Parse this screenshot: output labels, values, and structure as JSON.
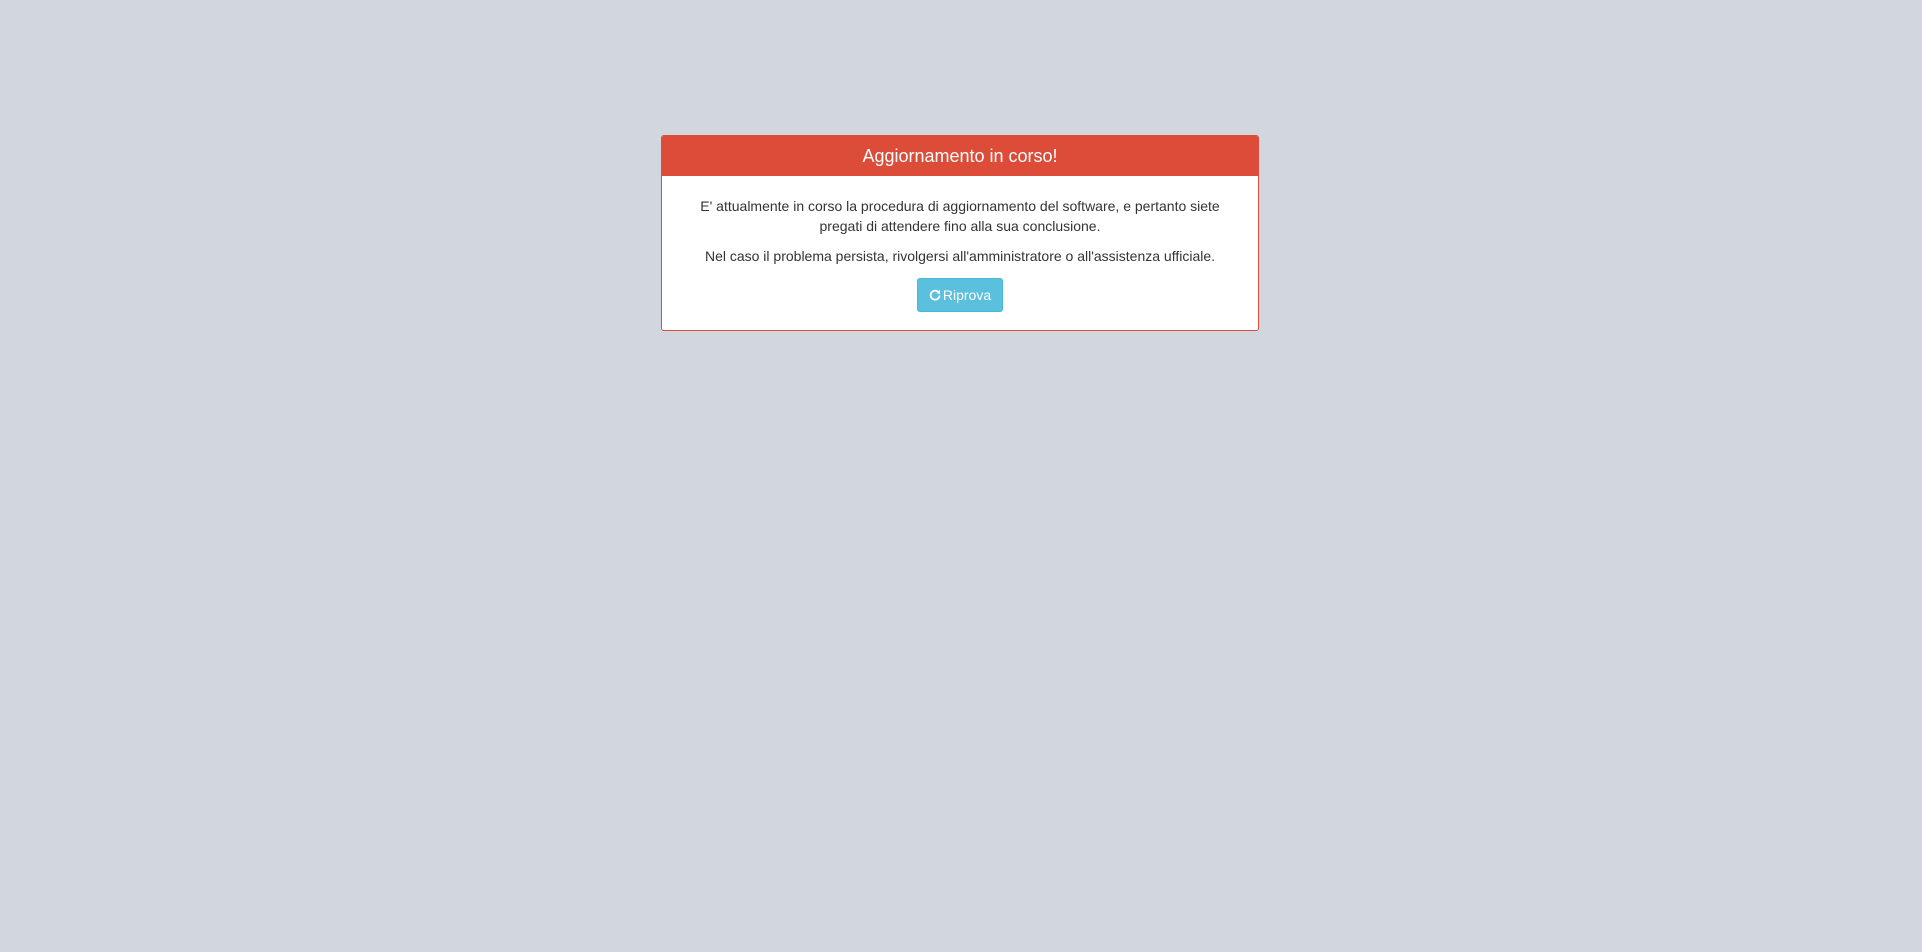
{
  "dialog": {
    "title": "Aggiornamento in corso!",
    "message_1": "E' attualmente in corso la procedura di aggiornamento del software, e pertanto siete pregati di attendere fino alla sua conclusione.",
    "message_2": "Nel caso il problema persista, rivolgersi all'amministratore o all'assistenza ufficiale.",
    "retry_button": {
      "label": "Riprova",
      "icon": "refresh-icon"
    }
  },
  "colors": {
    "background": "#d2d6de",
    "header": "#dd4b39",
    "button": "#5bc0de"
  }
}
